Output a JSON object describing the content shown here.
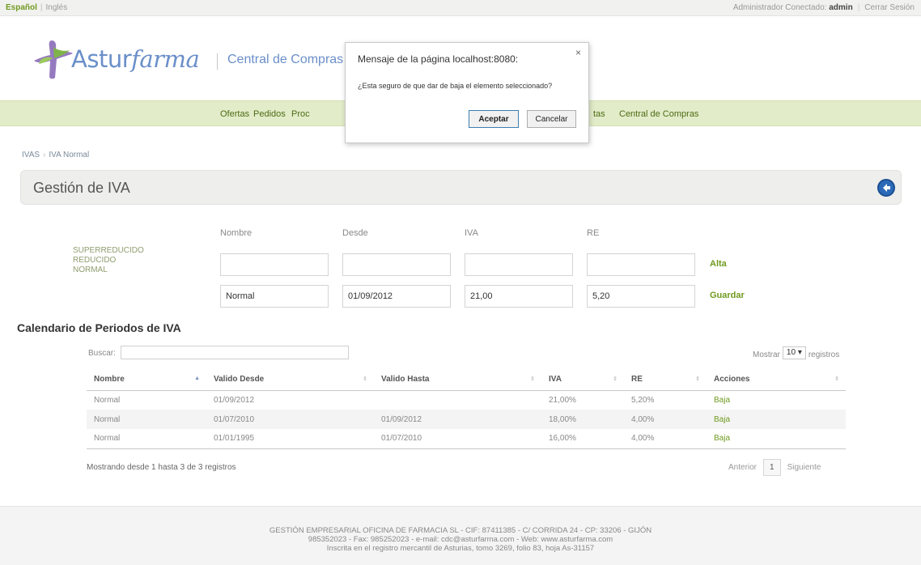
{
  "topbar": {
    "lang_active": "Español",
    "lang_other": "Inglés",
    "user_prefix": "Administrador Conectado:",
    "user_name": "admin",
    "logout": "Cerrar Sesión"
  },
  "brand": {
    "name_a": "Astur",
    "name_b": "farma",
    "subtitle": "Central de Compras",
    "color": "#6a8fc9"
  },
  "nav": {
    "items": [
      "Ofertas",
      "Pedidos",
      "Proc",
      "tas",
      "Central de Compras"
    ]
  },
  "breadcrumb": [
    "IVAS",
    "IVA Normal"
  ],
  "page_title": "Gestión de IVA",
  "form": {
    "headers": [
      "Nombre",
      "Desde",
      "IVA",
      "RE"
    ],
    "types": [
      "SUPERREDUCIDO",
      "REDUCIDO",
      "NORMAL"
    ],
    "new_row": [
      "",
      "",
      "",
      ""
    ],
    "edit_row": [
      "Normal",
      "01/09/2012",
      "21,00",
      "5,20"
    ],
    "alta_label": "Alta",
    "guardar_label": "Guardar"
  },
  "calendar": {
    "title": "Calendario de Periodos de IVA",
    "search_label": "Buscar:",
    "search_value": "",
    "show_label": "Mostrar",
    "show_value": "10",
    "records_label": "registros",
    "columns": [
      "Nombre",
      "Valido Desde",
      "Valido Hasta",
      "IVA",
      "RE",
      "Acciones"
    ],
    "rows": [
      [
        "Normal",
        "01/09/2012",
        "",
        "21,00%",
        "5,20%",
        "Baja"
      ],
      [
        "Normal",
        "01/07/2010",
        "01/09/2012",
        "18,00%",
        "4,00%",
        "Baja"
      ],
      [
        "Normal",
        "01/01/1995",
        "01/07/2010",
        "16,00%",
        "4,00%",
        "Baja"
      ]
    ],
    "info": "Mostrando desde 1 hasta 3 de 3 registros",
    "prev": "Anterior",
    "page": "1",
    "next": "Siguiente"
  },
  "footer": {
    "line1": "GESTIÓN EMPRESARIAL OFICINA DE FARMACIA SL - CIF: 87411385 - C/ CORRIDA 24 - CP: 33206 - GIJÓN",
    "line2": "985352023 - Fax: 985252023 - e-mail: cdc@asturfarma.com - Web: www.asturfarma.com",
    "line3": "Inscrita en el registro mercantil de Asturias, tomo 3269, folio 83, hoja As-31157"
  },
  "dialog": {
    "title": "Mensaje de la página localhost:8080:",
    "close": "×",
    "message": "¿Esta seguro de que dar de baja el elemento seleccionado?",
    "accept": "Aceptar",
    "cancel": "Cancelar"
  },
  "colors": {
    "accent_green": "#6f9a1f",
    "nav_bg": "#e2ecc9",
    "brand_blue": "#6a8fc9",
    "back_button": "#2c6ab8"
  },
  "icons": {
    "back": "arrow-left-circle-icon",
    "close": "close-icon",
    "sort_asc": "sort-asc-icon",
    "sort_both": "sort-both-icon",
    "dropdown": "chevron-down-icon"
  }
}
